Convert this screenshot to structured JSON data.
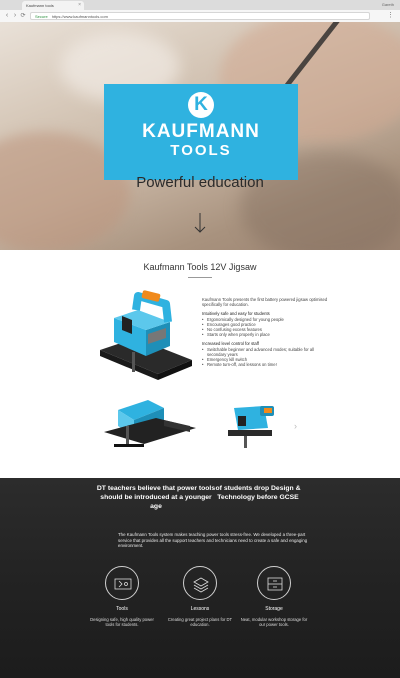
{
  "browser": {
    "tab_title": "Kaufmann tools",
    "tab_close": "×",
    "user_label": "Gareth",
    "back": "‹",
    "forward": "›",
    "reload": "⟳",
    "secure_label": "Secure",
    "url": "https://www.kaufmanntools.com",
    "menu": "⋮"
  },
  "hero": {
    "logo_letter": "K",
    "logo_name": "KAUFMANN",
    "logo_sub": "TOOLS",
    "tagline": "Powerful education"
  },
  "product": {
    "title": "Kaufmann Tools 12V Jigsaw",
    "intro": "Kaufmann Tools presents the first battery powered jigsaw optimised specifically for education.",
    "group1_heading": "Intuitively safe and easy for students",
    "group1_items": [
      "Ergonomically designed for young people",
      "Encourages good practice",
      "No confusing excess features",
      "Starts only when properly in place"
    ],
    "group2_heading": "Increased level control for staff",
    "group2_items": [
      "Switchable beginner and advanced modes; suitable for all secondary years",
      "Emergency kill switch",
      "Remote turn-off, and lessons on time!"
    ],
    "carousel_next": "›"
  },
  "about": {
    "belief_left": "DT teachers believe that power tools should be introduced at a younger age",
    "belief_right": "of students drop Design & Technology before GCSE",
    "intro": "The Kaufmann Tools system makes teaching power tools stress-free. We developed a three-part service that provides all the support teachers and technicians need to create a safe and engaging environment.",
    "features": [
      {
        "name": "Tools",
        "desc": "Designing safe, high quality power tools for students."
      },
      {
        "name": "Lessons",
        "desc": "Creating great project plans for DT education."
      },
      {
        "name": "Storage",
        "desc": "Neat, modular workshop storage for our power tools."
      }
    ]
  },
  "colors": {
    "brand": "#2fb2e0",
    "accent_orange": "#f08a1c",
    "dark_bg": "#232323"
  }
}
